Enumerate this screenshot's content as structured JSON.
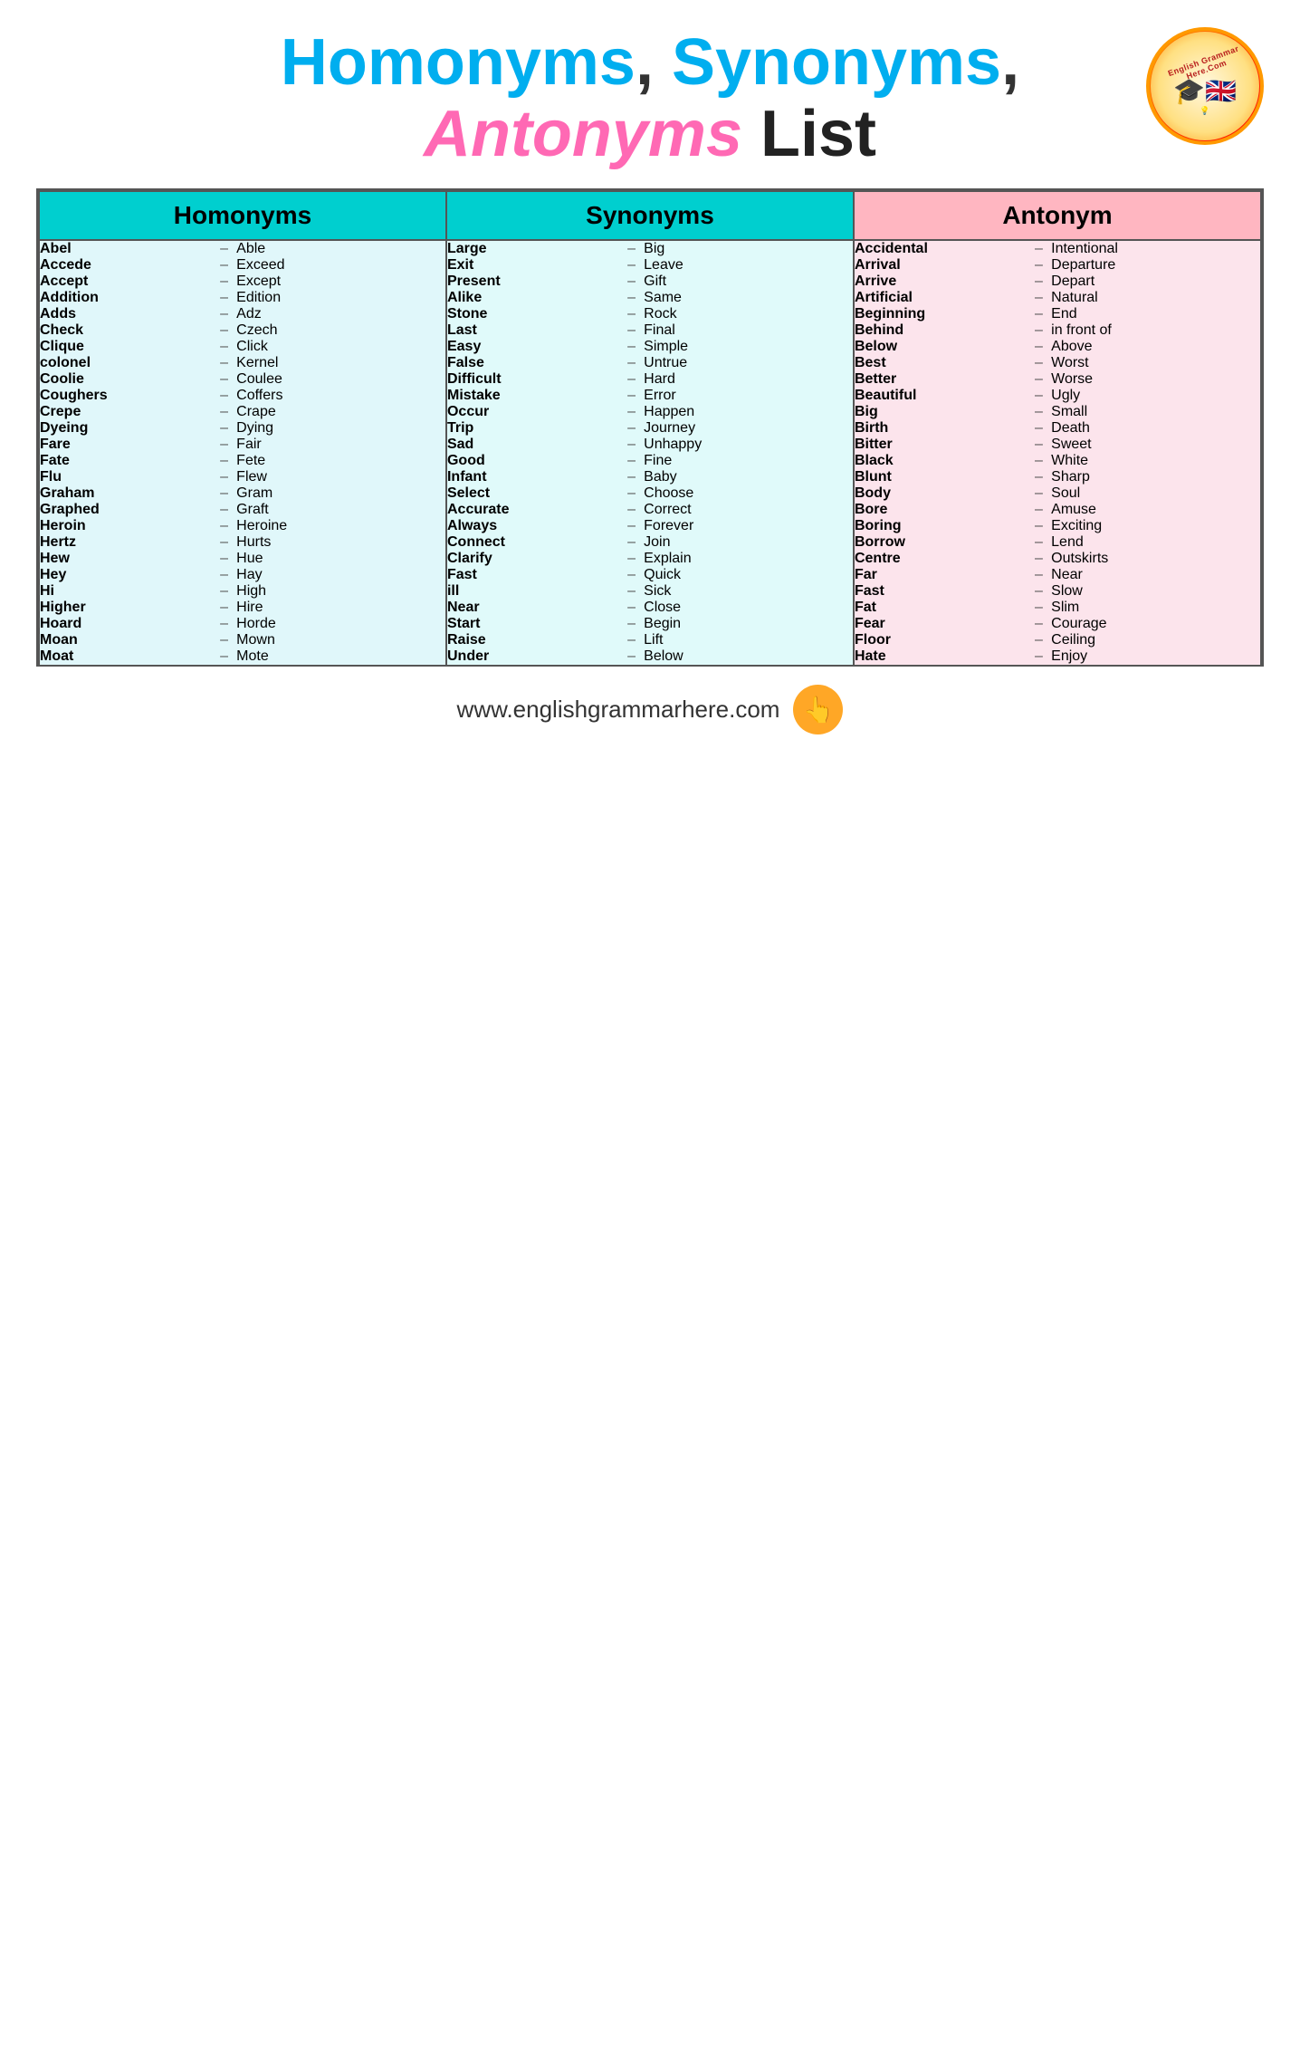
{
  "header": {
    "title_line1_part1": "Homonyms",
    "title_line1_part2": ", Synonyms,",
    "title_line2_part1": "Antonyms",
    "title_line2_part2": " List"
  },
  "columns": {
    "homonyms_header": "Homonyms",
    "synonyms_header": "Synonyms",
    "antonyms_header": "Antonym"
  },
  "homonyms": [
    {
      "word": "Abel",
      "dash": "–",
      "value": "Able"
    },
    {
      "word": "Accede",
      "dash": "–",
      "value": "Exceed"
    },
    {
      "word": "Accept",
      "dash": "–",
      "value": "Except"
    },
    {
      "word": "Addition",
      "dash": "–",
      "value": "Edition"
    },
    {
      "word": "Adds",
      "dash": "–",
      "value": "Adz"
    },
    {
      "word": "Check",
      "dash": "–",
      "value": "Czech"
    },
    {
      "word": "Clique",
      "dash": "–",
      "value": "Click"
    },
    {
      "word": "colonel",
      "dash": "–",
      "value": "Kernel"
    },
    {
      "word": "Coolie",
      "dash": "–",
      "value": "Coulee"
    },
    {
      "word": "Coughers",
      "dash": "–",
      "value": "Coffers"
    },
    {
      "word": "Crepe",
      "dash": "–",
      "value": "Crape"
    },
    {
      "word": "Dyeing",
      "dash": "–",
      "value": "Dying"
    },
    {
      "word": "Fare",
      "dash": "–",
      "value": "Fair"
    },
    {
      "word": "Fate",
      "dash": "–",
      "value": "Fete"
    },
    {
      "word": "Flu",
      "dash": "–",
      "value": "Flew"
    },
    {
      "word": "Graham",
      "dash": "–",
      "value": "Gram"
    },
    {
      "word": "Graphed",
      "dash": "–",
      "value": "Graft"
    },
    {
      "word": "Heroin",
      "dash": "–",
      "value": "Heroine"
    },
    {
      "word": "Hertz",
      "dash": "–",
      "value": "Hurts"
    },
    {
      "word": "Hew",
      "dash": "–",
      "value": "Hue"
    },
    {
      "word": "Hey",
      "dash": "–",
      "value": "Hay"
    },
    {
      "word": "Hi",
      "dash": "–",
      "value": "High"
    },
    {
      "word": "Higher",
      "dash": "–",
      "value": "Hire"
    },
    {
      "word": "Hoard",
      "dash": "–",
      "value": "Horde"
    },
    {
      "word": "Moan",
      "dash": "–",
      "value": "Mown"
    },
    {
      "word": "Moat",
      "dash": "–",
      "value": "Mote"
    }
  ],
  "synonyms": [
    {
      "word": "Large",
      "dash": "–",
      "value": "Big"
    },
    {
      "word": "Exit",
      "dash": "–",
      "value": "Leave"
    },
    {
      "word": "Present",
      "dash": "–",
      "value": "Gift"
    },
    {
      "word": "Alike",
      "dash": "–",
      "value": "Same"
    },
    {
      "word": "Stone",
      "dash": "–",
      "value": "Rock"
    },
    {
      "word": "Last",
      "dash": "–",
      "value": "Final"
    },
    {
      "word": "Easy",
      "dash": "–",
      "value": "Simple"
    },
    {
      "word": "False",
      "dash": "–",
      "value": "Untrue"
    },
    {
      "word": "Difficult",
      "dash": "–",
      "value": "Hard"
    },
    {
      "word": "Mistake",
      "dash": "–",
      "value": "Error"
    },
    {
      "word": "Occur",
      "dash": "–",
      "value": "Happen"
    },
    {
      "word": "Trip",
      "dash": "–",
      "value": "Journey"
    },
    {
      "word": "Sad",
      "dash": "–",
      "value": "Unhappy"
    },
    {
      "word": "Good",
      "dash": "–",
      "value": "Fine"
    },
    {
      "word": "Infant",
      "dash": "–",
      "value": "Baby"
    },
    {
      "word": "Select",
      "dash": "–",
      "value": "Choose"
    },
    {
      "word": "Accurate",
      "dash": "–",
      "value": "Correct"
    },
    {
      "word": "Always",
      "dash": "–",
      "value": "Forever"
    },
    {
      "word": "Connect",
      "dash": "–",
      "value": "Join"
    },
    {
      "word": "Clarify",
      "dash": "–",
      "value": "Explain"
    },
    {
      "word": "Fast",
      "dash": "–",
      "value": "Quick"
    },
    {
      "word": "ill",
      "dash": "–",
      "value": "Sick"
    },
    {
      "word": "Near",
      "dash": "–",
      "value": "Close"
    },
    {
      "word": "Start",
      "dash": "–",
      "value": "Begin"
    },
    {
      "word": "Raise",
      "dash": "–",
      "value": "Lift"
    },
    {
      "word": "Under",
      "dash": "–",
      "value": "Below"
    }
  ],
  "antonyms": [
    {
      "word": "Accidental",
      "dash": "–",
      "value": "Intentional"
    },
    {
      "word": "Arrival",
      "dash": "–",
      "value": "Departure"
    },
    {
      "word": "Arrive",
      "dash": "–",
      "value": "Depart"
    },
    {
      "word": "Artificial",
      "dash": "–",
      "value": "Natural"
    },
    {
      "word": "Beginning",
      "dash": "–",
      "value": "End"
    },
    {
      "word": "Behind",
      "dash": "–",
      "value": "in front of"
    },
    {
      "word": "Below",
      "dash": "–",
      "value": "Above"
    },
    {
      "word": "Best",
      "dash": "–",
      "value": "Worst"
    },
    {
      "word": "Better",
      "dash": "–",
      "value": "Worse"
    },
    {
      "word": "Beautiful",
      "dash": "–",
      "value": "Ugly"
    },
    {
      "word": "Big",
      "dash": "–",
      "value": "Small"
    },
    {
      "word": "Birth",
      "dash": "–",
      "value": "Death"
    },
    {
      "word": "Bitter",
      "dash": "–",
      "value": "Sweet"
    },
    {
      "word": "Black",
      "dash": "–",
      "value": "White"
    },
    {
      "word": "Blunt",
      "dash": "–",
      "value": "Sharp"
    },
    {
      "word": "Body",
      "dash": "–",
      "value": "Soul"
    },
    {
      "word": "Bore",
      "dash": "–",
      "value": "Amuse"
    },
    {
      "word": "Boring",
      "dash": "–",
      "value": "Exciting"
    },
    {
      "word": "Borrow",
      "dash": "–",
      "value": "Lend"
    },
    {
      "word": "Centre",
      "dash": "–",
      "value": "Outskirts"
    },
    {
      "word": "Far",
      "dash": "–",
      "value": "Near"
    },
    {
      "word": "Fast",
      "dash": "–",
      "value": "Slow"
    },
    {
      "word": "Fat",
      "dash": "–",
      "value": "Slim"
    },
    {
      "word": "Fear",
      "dash": "–",
      "value": "Courage"
    },
    {
      "word": "Floor",
      "dash": "–",
      "value": "Ceiling"
    },
    {
      "word": "Hate",
      "dash": "–",
      "value": "Enjoy"
    }
  ],
  "footer": {
    "url": "www.englishgrammarhere.com"
  }
}
